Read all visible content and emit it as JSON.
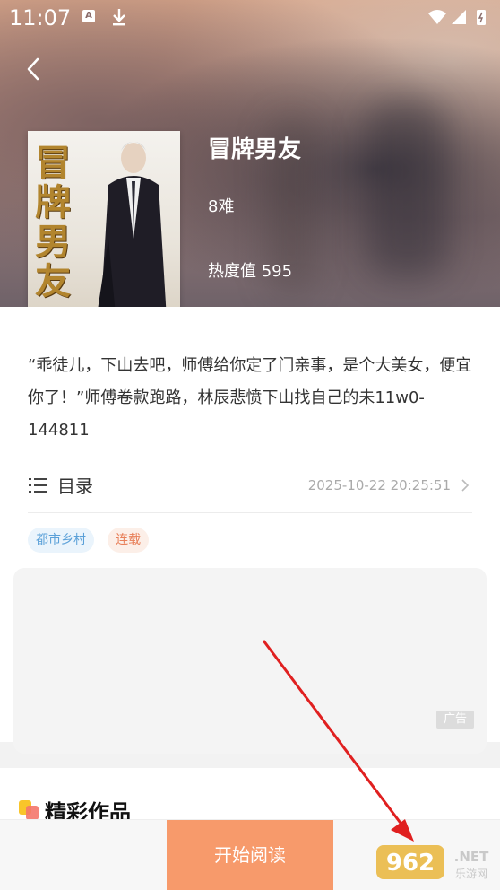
{
  "status_bar": {
    "time": "11:07",
    "left_icons": [
      "app-a-icon",
      "download-icon"
    ],
    "right_icons": [
      "wifi-icon",
      "signal-icon",
      "battery-icon"
    ]
  },
  "header": {
    "back_icon": "chevron-left-icon"
  },
  "book": {
    "cover_title": "冒牌男友",
    "title": "冒牌男友",
    "author": "8难",
    "heat": "热度值 595",
    "description": "“乖徒儿，下山去吧，师傅给你定了门亲事，是个大美女，便宜你了！”师傅卷款跑路，林辰悲愤下山找自己的未11w0-144811"
  },
  "toc": {
    "label": "目录",
    "updated": "2025-10-22 20:25:51"
  },
  "tags": [
    "都市乡村",
    "连载"
  ],
  "ad": {
    "label": "广告"
  },
  "works": {
    "title": "精彩作品"
  },
  "bottom": {
    "start_read": "开始阅读",
    "watermark_number": "962",
    "watermark_suffix": ".NET",
    "watermark_site": "乐游网"
  },
  "colors": {
    "accent": "#f79a6b",
    "tag_blue": "#5aa0d8",
    "tag_orange": "#e8805a",
    "annotation_arrow": "#e02020"
  }
}
